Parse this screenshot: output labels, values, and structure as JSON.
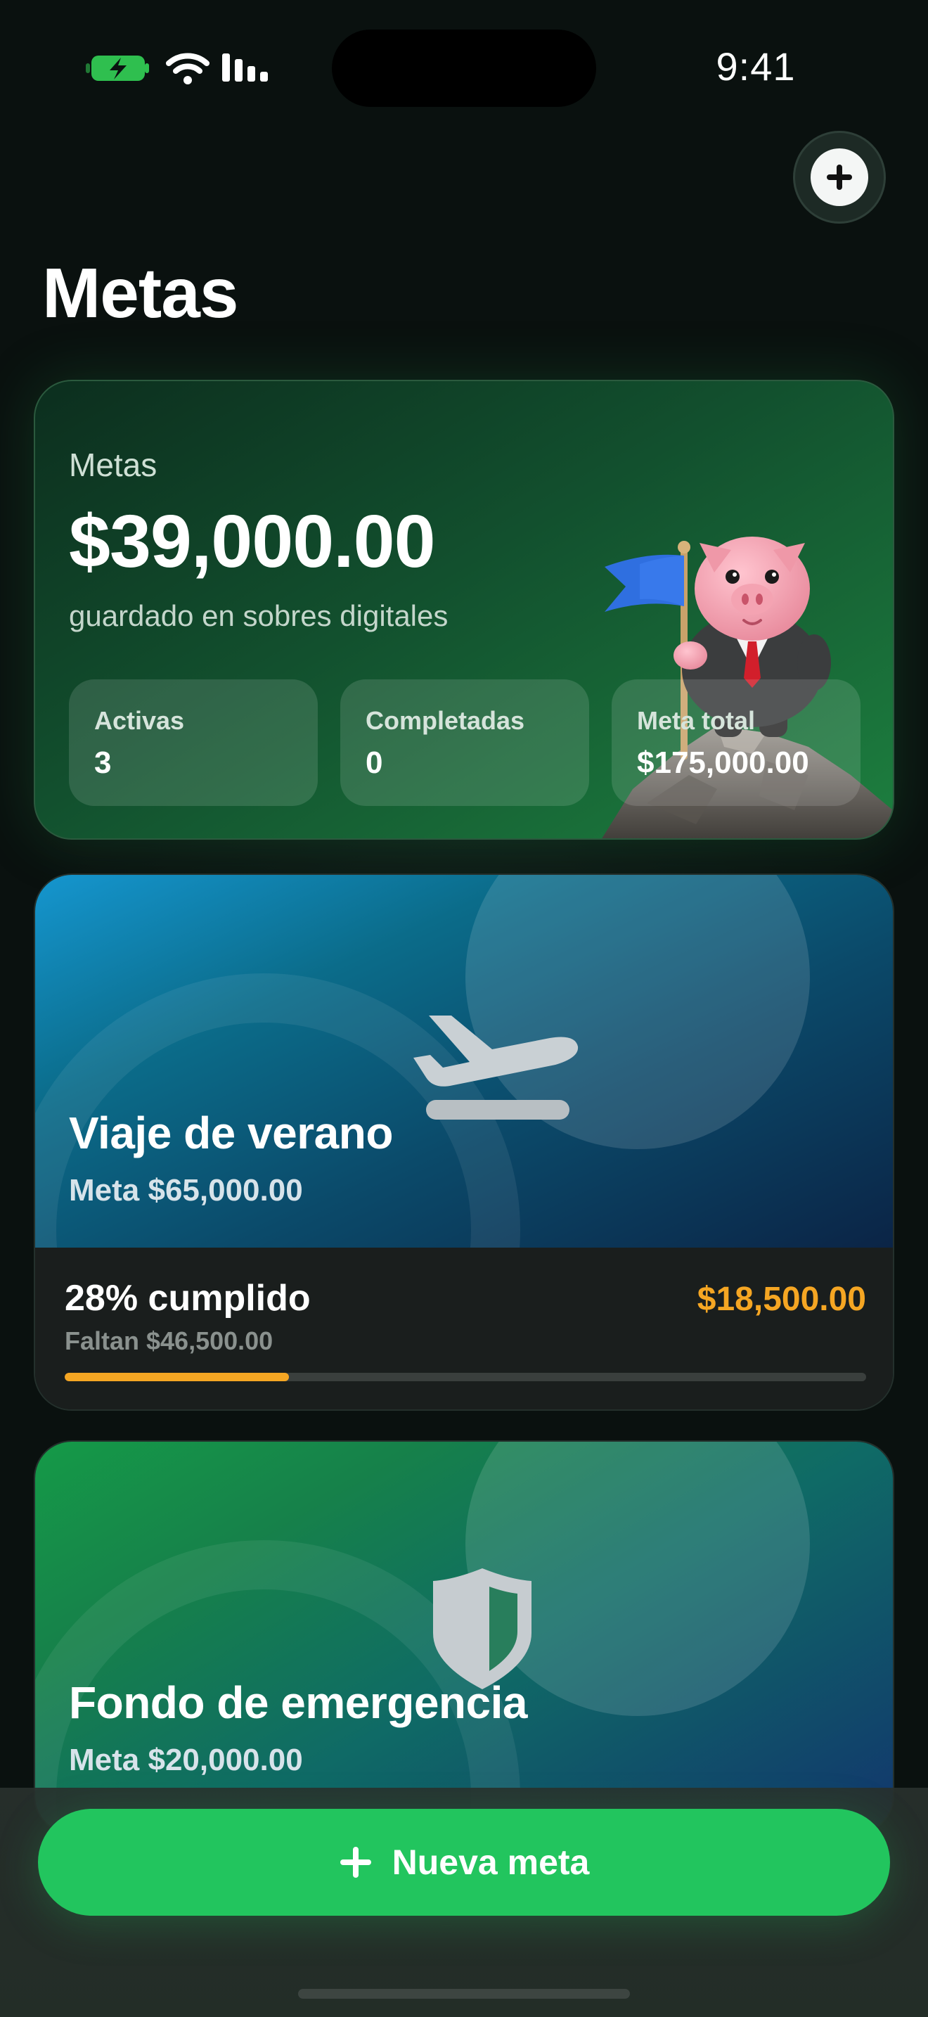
{
  "status_bar": {
    "time": "9:41"
  },
  "page": {
    "title": "Metas"
  },
  "summary": {
    "label": "Metas",
    "amount": "$39,000.00",
    "subtitle": "guardado en sobres digitales",
    "stats": [
      {
        "label": "Activas",
        "value": "3"
      },
      {
        "label": "Completadas",
        "value": "0"
      },
      {
        "label": "Meta total",
        "value": "$175,000.00"
      }
    ]
  },
  "goals": [
    {
      "title": "Viaje de verano",
      "target": "Meta $65,000.00",
      "icon": "airplane-takeoff-icon",
      "progress_label": "28% cumplido",
      "progress_fraction": 0.28,
      "remaining": "Faltan $46,500.00",
      "saved": "$18,500.00"
    },
    {
      "title": "Fondo de emergencia",
      "target": "Meta $20,000.00",
      "icon": "shield-icon"
    }
  ],
  "actions": {
    "new_goal_label": "Nueva meta"
  },
  "colors": {
    "accent_green": "#22c55e",
    "progress_orange": "#f5a623"
  }
}
